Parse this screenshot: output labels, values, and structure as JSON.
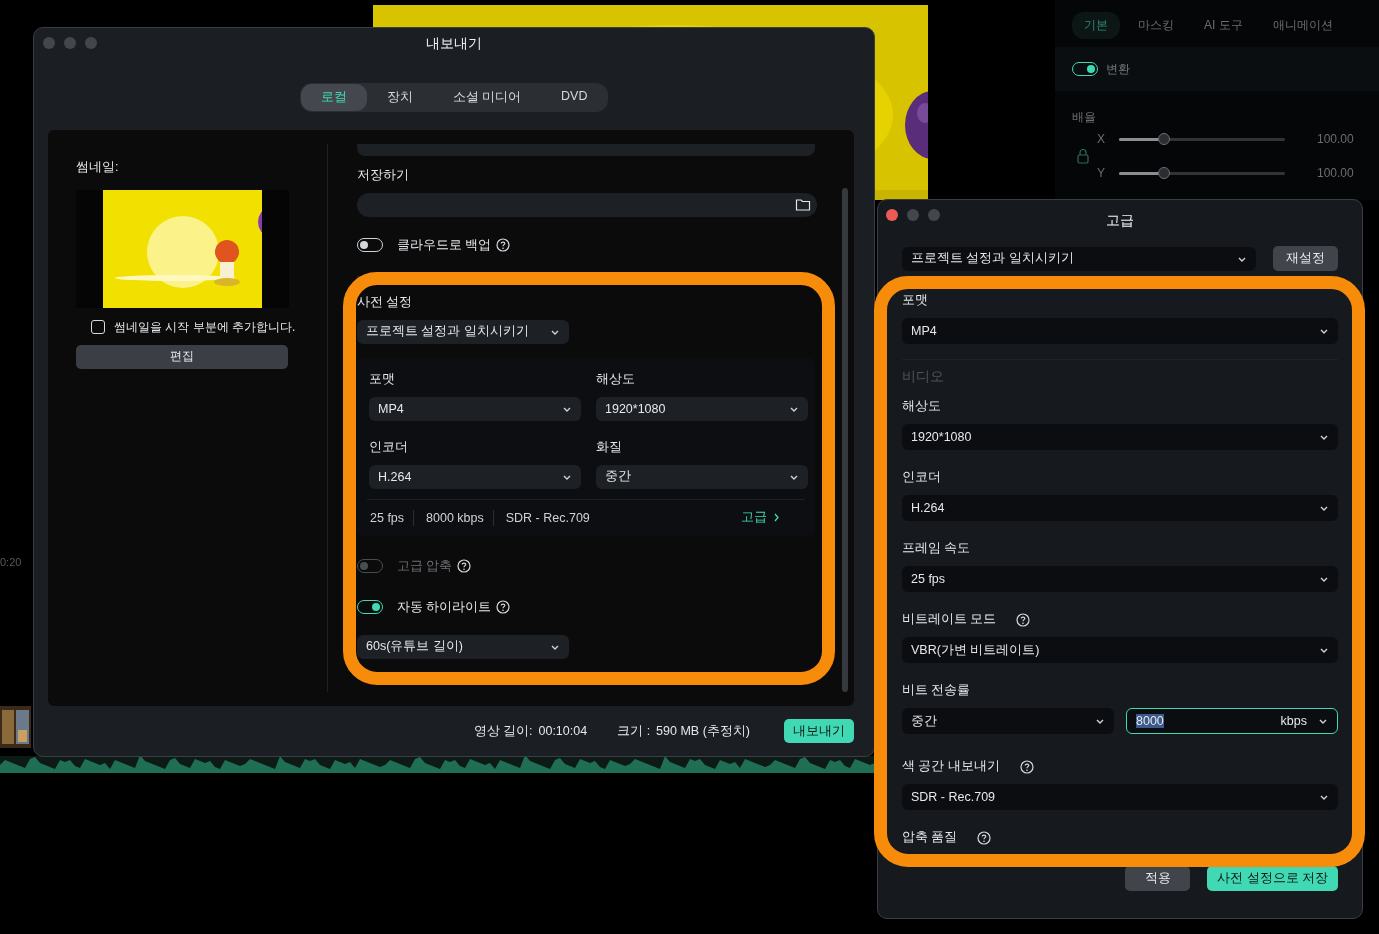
{
  "background_app": {
    "tabs": [
      {
        "label": "기본",
        "selected": true
      },
      {
        "label": "마스킹",
        "selected": false
      },
      {
        "label": "AI 도구",
        "selected": false
      },
      {
        "label": "애니메이션",
        "selected": false
      }
    ],
    "transform": {
      "label": "변환",
      "on": true
    },
    "scale": {
      "label": "배율",
      "rows": [
        {
          "axis": "X",
          "level": 0.27,
          "value": "100.00"
        },
        {
          "axis": "Y",
          "level": 0.27,
          "value": "100.00"
        }
      ]
    },
    "timeline_time": "0:20"
  },
  "export_window": {
    "title": "내보내기",
    "active": false,
    "tabs": [
      {
        "label": "로컬",
        "selected": true
      },
      {
        "label": "장치",
        "selected": false
      },
      {
        "label": "소셜 미디어",
        "selected": false
      },
      {
        "label": "DVD",
        "selected": false
      }
    ],
    "thumbnail": {
      "label": "썸네일:",
      "add_at_start": {
        "label": "썸네일을 시작 부분에 추가합니다.",
        "checked": false
      },
      "edit_button": "편집"
    },
    "save_label": "저장하기",
    "cloud_backup": {
      "label": "클라우드로 백업",
      "on": false,
      "help": true
    },
    "preset": {
      "label": "사전 설정",
      "value": "프로젝트 설정과 일치시키기"
    },
    "fields": [
      {
        "label": "포맷",
        "value": "MP4"
      },
      {
        "label": "해상도",
        "value": "1920*1080"
      },
      {
        "label": "인코더",
        "value": "H.264"
      },
      {
        "label": "화질",
        "value": "중간"
      }
    ],
    "summary": [
      "25 fps",
      "8000 kbps",
      "SDR - Rec.709"
    ],
    "advanced_link": "고급",
    "advanced_compression": {
      "label": "고급 압축",
      "on": false,
      "disabled": true,
      "help": true
    },
    "auto_highlight": {
      "label": "자동 하이라이트",
      "on": true,
      "disabled": false,
      "help": true,
      "value": "60s(유튜브 길이)"
    },
    "footer": {
      "duration_label": "영상 길이:",
      "duration": "00:10:04",
      "size_label": "크기 :",
      "size": "590 MB (추정치)",
      "export_button": "내보내기"
    }
  },
  "advanced_window": {
    "title": "고급",
    "active": true,
    "preset": "프로젝트 설정과 일치시키기",
    "reset_button": "재설정",
    "format": {
      "label": "포맷",
      "value": "MP4"
    },
    "section": "비디오",
    "fields": [
      {
        "label": "해상도",
        "value": "1920*1080",
        "help": false
      },
      {
        "label": "인코더",
        "value": "H.264",
        "help": false
      },
      {
        "label": "프레임 속도",
        "value": "25 fps",
        "help": false
      },
      {
        "label": "비트레이트 모드",
        "value": "VBR(가변 비트레이트)",
        "help": true
      }
    ],
    "bitrate": {
      "label": "비트 전송률",
      "quality": "중간",
      "value": "8000",
      "unit": "kbps",
      "focused": true
    },
    "color_space": {
      "label": "색 공간 내보내기",
      "value": "SDR - Rec.709",
      "help": true
    },
    "compression_quality": {
      "label": "압축 품질",
      "help": true
    },
    "apply_button": "적용",
    "save_button": "사전 설정으로 저장"
  }
}
